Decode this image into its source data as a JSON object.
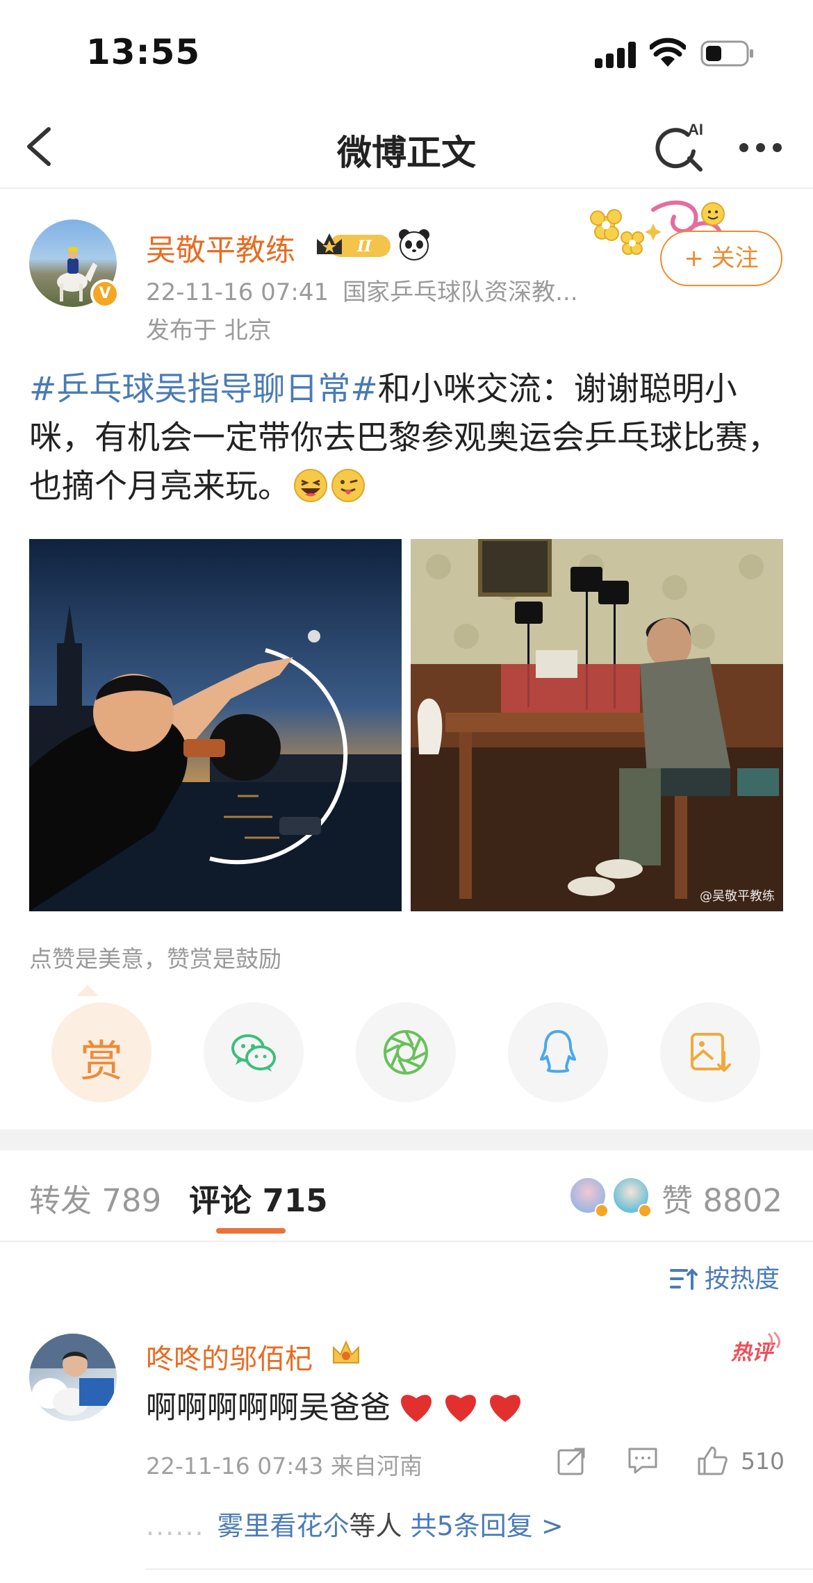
{
  "status_bar": {
    "time": "13:55"
  },
  "nav": {
    "title": "微博正文",
    "ai_label": "AI"
  },
  "author": {
    "name": "吴敬平教练",
    "verified": "V",
    "vip_level": "II",
    "timestamp": "22-11-16 07:41",
    "source": "国家乒乓球队资深教...",
    "location": "发布于 北京",
    "follow_label": "+ 关注"
  },
  "post": {
    "hashtag": "#乒乓球吴指导聊日常#",
    "text": "和小咪交流：谢谢聪明小咪，有机会一定带你去巴黎参观奥运会乒乓球比赛，也摘个月亮来玩。",
    "emojis": [
      "laughing-emoji",
      "tongue-emoji"
    ],
    "image_watermark": "@吴敬平教练"
  },
  "reward": {
    "hint": "点赞是美意，赞赏是鼓励",
    "reward_label": "赏"
  },
  "share_icons": [
    "wechat-icon",
    "moments-icon",
    "qq-icon",
    "save-image-icon"
  ],
  "tabs": {
    "repost": "转发 789",
    "comment": "评论 715",
    "like": "赞 8802"
  },
  "sort": {
    "label": "按热度"
  },
  "comment": {
    "user": "咚咚的邬佰杞",
    "hot_label": "热评",
    "text": "啊啊啊啊啊吴爸爸",
    "timestamp": "22-11-16 07:43",
    "location": "来自河南",
    "like_count": "510",
    "reply_user": "雾里看花尒",
    "reply_mid": "等人 ",
    "reply_link": "共5条回复 >"
  },
  "colors": {
    "accent_orange": "#e86b22",
    "link_blue": "#4a7bb7",
    "hot_red": "#e8505b"
  }
}
